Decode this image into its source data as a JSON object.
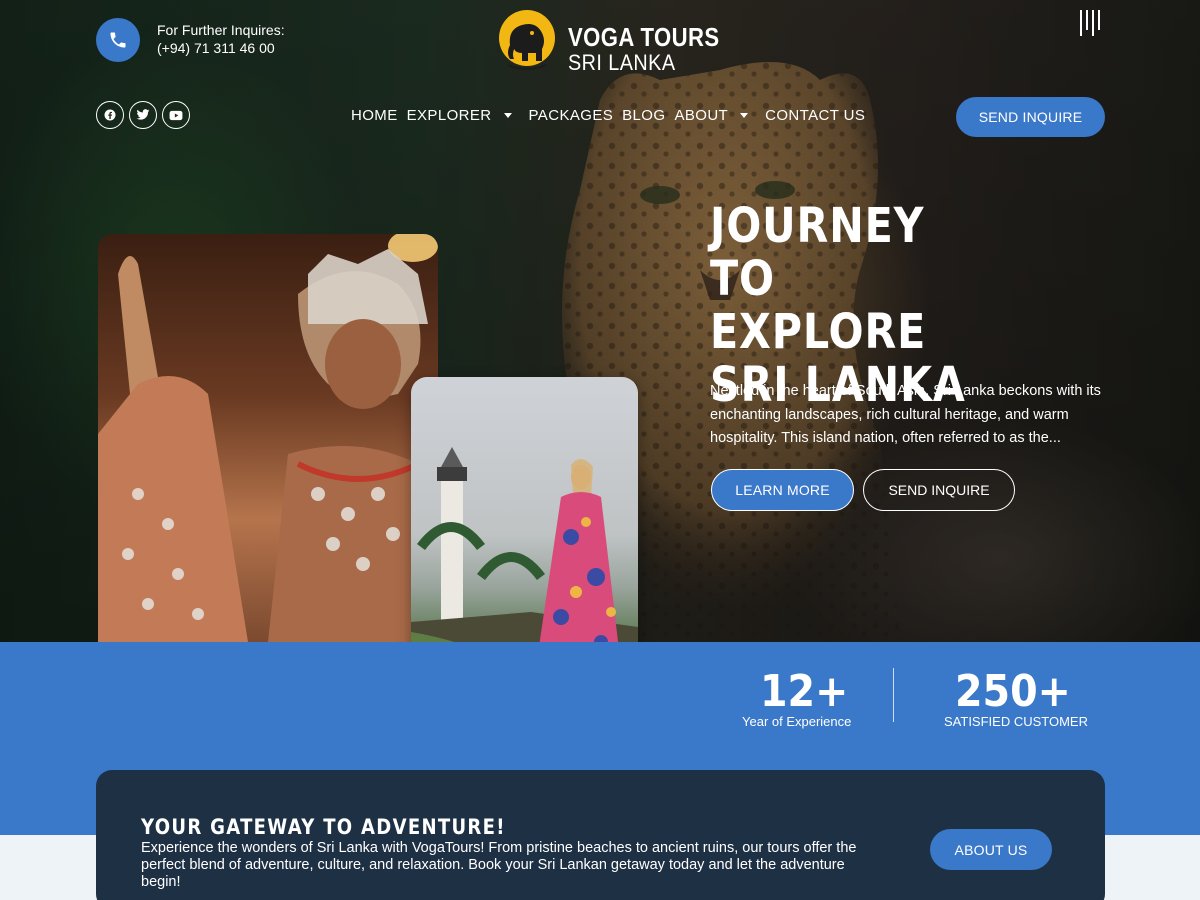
{
  "contact": {
    "label": "For Further Inquires:",
    "phone": "(+94) 71 311 46 00"
  },
  "logo": {
    "line1": "VOGA TOURS",
    "line2": "SRI LANKA"
  },
  "social_icons": [
    "facebook-icon",
    "twitter-icon",
    "youtube-icon"
  ],
  "nav": {
    "items": [
      {
        "label": "HOME",
        "dropdown": false
      },
      {
        "label": "EXPLORER",
        "dropdown": true
      },
      {
        "label": "PACKAGES",
        "dropdown": false
      },
      {
        "label": "BLOG",
        "dropdown": false
      },
      {
        "label": "ABOUT",
        "dropdown": true
      },
      {
        "label": "CONTACT US",
        "dropdown": false
      }
    ],
    "cta": "SEND INQUIRE"
  },
  "hero": {
    "title": "JOURNEY TO EXPLORE SRI LANKA",
    "description": "Nestled in the heart of South Asia, Sri Lanka beckons with its enchanting landscapes, rich cultural heritage, and warm hospitality. This island nation, often referred to as the...",
    "primary_button": "LEARN MORE",
    "secondary_button": "SEND INQUIRE"
  },
  "stats": [
    {
      "value": "12+",
      "label": "Year of Experience"
    },
    {
      "value": "250+",
      "label": "SATISFIED CUSTOMER"
    }
  ],
  "gateway": {
    "title": "YOUR GATEWAY TO ADVENTURE!",
    "text": "Experience the wonders of Sri Lanka with VogaTours! From pristine beaches to ancient ruins, our tours offer the perfect blend of adventure, culture, and relaxation. Book your Sri Lankan getaway today and let the adventure begin!",
    "button": "ABOUT US"
  },
  "colors": {
    "accent": "#3a78c9",
    "dark_panel": "#1e3044",
    "logo_yellow": "#f2b713"
  }
}
